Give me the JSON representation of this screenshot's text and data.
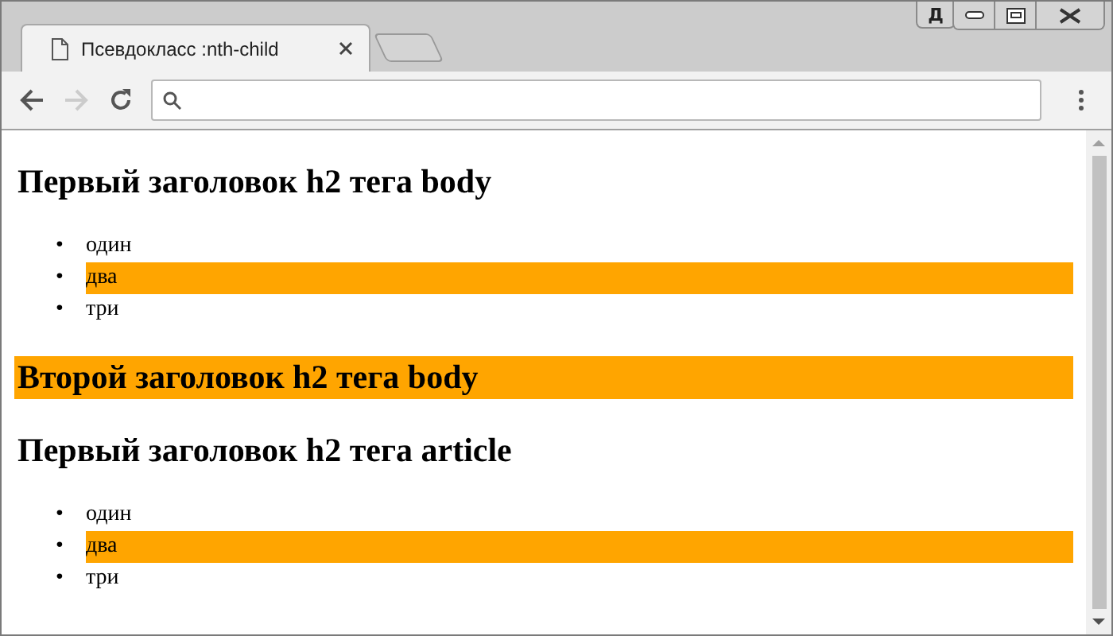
{
  "window": {
    "profile_button": "Д"
  },
  "tabs": [
    {
      "title": "Псевдокласс :nth-child",
      "selected": true
    }
  ],
  "content": [
    {
      "kind": "heading",
      "text": "Первый заголовок h2 тега body",
      "highlighted": false
    },
    {
      "kind": "list",
      "items": [
        {
          "marker": "•",
          "text": "один",
          "highlighted": false
        },
        {
          "marker": "•",
          "text": "два",
          "highlighted": true
        },
        {
          "marker": "•",
          "text": "три",
          "highlighted": false
        }
      ]
    },
    {
      "kind": "heading",
      "text": "Второй заголовок h2 тега body",
      "highlighted": true
    },
    {
      "kind": "heading",
      "text": "Первый заголовок h2 тега article",
      "highlighted": false
    },
    {
      "kind": "list",
      "items": [
        {
          "marker": "•",
          "text": "один",
          "highlighted": false
        },
        {
          "marker": "•",
          "text": "два",
          "highlighted": true
        },
        {
          "marker": "•",
          "text": "три",
          "highlighted": false
        }
      ]
    }
  ]
}
